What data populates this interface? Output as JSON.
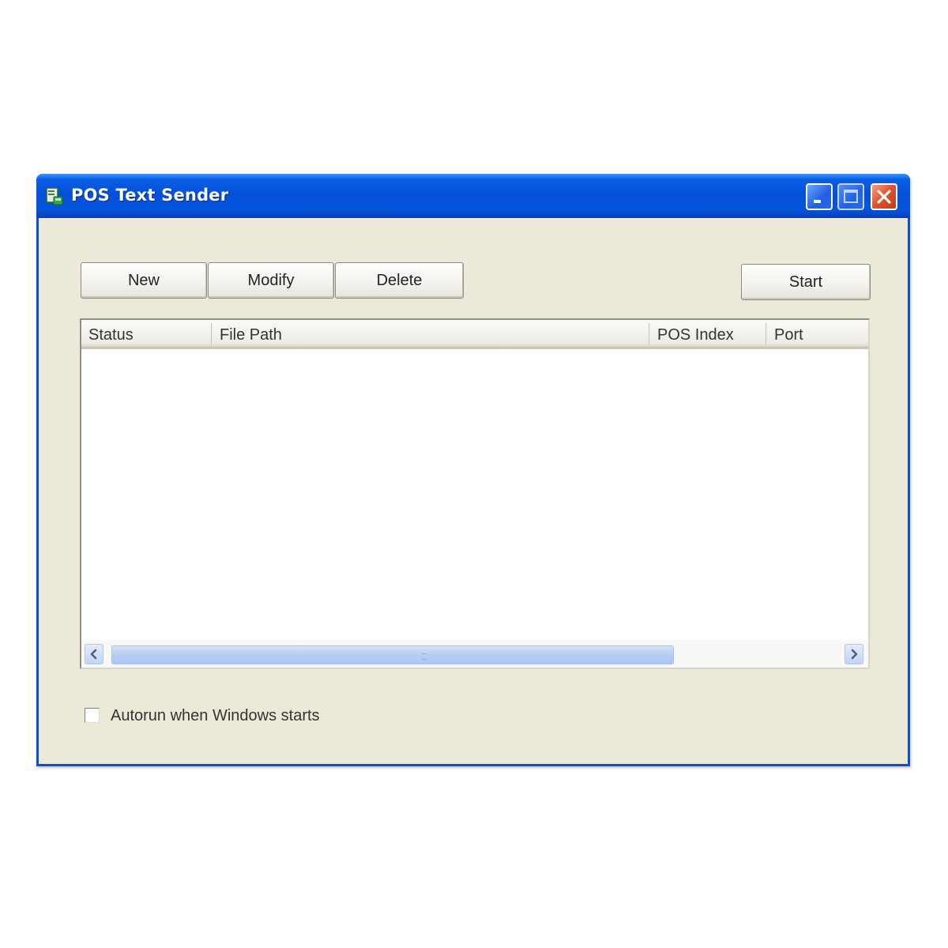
{
  "window": {
    "title": "POS Text Sender",
    "controls": {
      "minimize": "minimize-icon",
      "maximize": "maximize-icon",
      "close": "close-icon"
    }
  },
  "toolbar": {
    "new_label": "New",
    "modify_label": "Modify",
    "delete_label": "Delete",
    "start_label": "Start"
  },
  "list": {
    "columns": [
      "Status",
      "File Path",
      "POS Index",
      "Port"
    ],
    "rows": []
  },
  "options": {
    "autorun_label": "Autorun when Windows starts",
    "autorun_checked": false
  },
  "colors": {
    "titlebar": "#0451d8",
    "window_face": "#ece9d8",
    "close_button": "#e0502a"
  }
}
